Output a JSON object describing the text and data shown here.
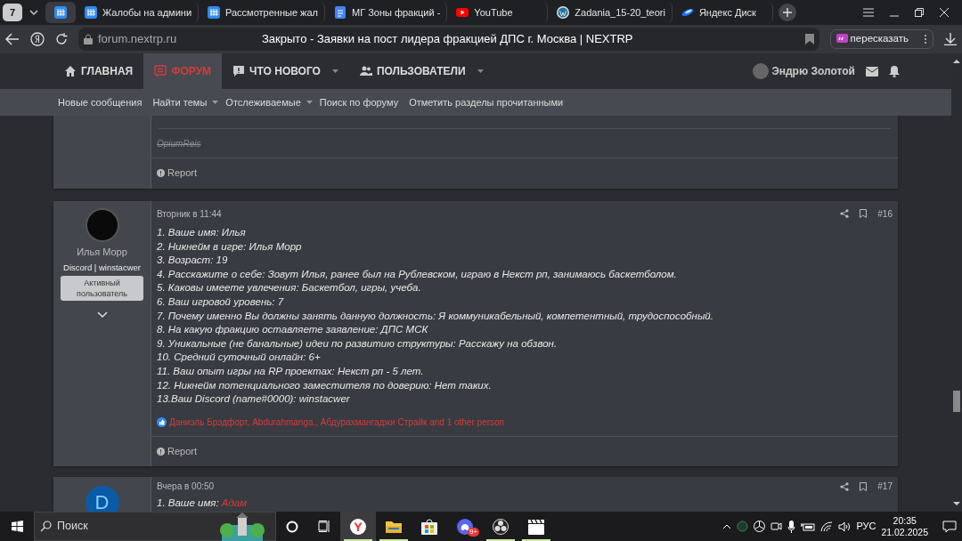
{
  "browser": {
    "tab_count": "7",
    "tabs": [
      {
        "kind": "forum",
        "selected": true
      },
      {
        "kind": "forum",
        "title": "Жалобы на админи",
        "selected": false
      },
      {
        "kind": "forum",
        "title": "Рассмотренные жал",
        "selected": false
      },
      {
        "kind": "doc",
        "title": "МГ Зоны фракций -",
        "selected": false
      },
      {
        "kind": "youtube",
        "title": "YouTube",
        "selected": false
      },
      {
        "kind": "wordpress",
        "title": "Zadania_15-20_teori",
        "selected": false
      },
      {
        "kind": "disk",
        "title": "Яндекс Диск",
        "selected": false
      }
    ],
    "domain": "forum.nextrp.ru",
    "page_title": "Закрыто - Заявки на пост лидера фракцией ДПС г. Москва | NEXTRP",
    "summarize_button": "пересказать"
  },
  "forum_nav": {
    "items": [
      {
        "kind": "home",
        "label": "ГЛАВНАЯ",
        "selected": false,
        "dropdown": false
      },
      {
        "kind": "forum",
        "label": "ФОРУМ",
        "selected": true,
        "dropdown": false
      },
      {
        "kind": "news",
        "label": "ЧТО НОВОГО",
        "selected": false,
        "dropdown": true
      },
      {
        "kind": "users",
        "label": "ПОЛЬЗОВАТЕЛИ",
        "selected": false,
        "dropdown": true
      }
    ],
    "user_name": "Эндрю Золотой"
  },
  "sub_nav": [
    {
      "label": "Новые сообщения",
      "dropdown": false
    },
    {
      "label": "Найти темы",
      "dropdown": true
    },
    {
      "label": "Отслеживаемые",
      "dropdown": true
    },
    {
      "label": "Поиск по форуму",
      "dropdown": false
    },
    {
      "label": "Отметить разделы прочитанными",
      "dropdown": false
    }
  ],
  "posts": [
    {
      "kind": "cut",
      "signature": "OpiumReis",
      "report": "Report"
    },
    {
      "kind": "full",
      "author": "Илья Морр",
      "author_title": "Discord | winstacwer",
      "user_badge": "Активный пользователь",
      "date": "Вторник в 11:44",
      "number": "#16",
      "lines": [
        {
          "text": "1. Ваше имя: Илья"
        },
        {
          "text": "2. Никнейм в игре: Илья Морр"
        },
        {
          "text": "3. Возраст: 19"
        },
        {
          "text": "4. Расскажите о себе: Зовут Илья, ранее был на Рублевском, играю в Некст рп, занимаюсь баскетболом."
        },
        {
          "text": "5. Каковы имеете увлечения: Баскетбол, игры, учеба."
        },
        {
          "text": "6. Ваш игровой уровень: 7"
        },
        {
          "text": "7. Почему именно Вы должны занять данную должность: Я коммуникабельный, компетентный, трудоспособный."
        },
        {
          "text": "8. На какую фракцию оставляете заявление: ДПС МСК"
        },
        {
          "text": "9. Уникальные (не банальные) идеи по развитию структуры: Расскажу на обзвон."
        },
        {
          "text": "10. Средний суточный онлайн: 6+"
        },
        {
          "text": "11. Ваш опыт игры на RP проектах: Некст рп - 5 лет."
        },
        {
          "text": "12. Никнейм потенциального заместителя по доверию: Нет таких."
        },
        {
          "text": "13.Ваш Discord (name#0000): winstacwer"
        }
      ],
      "reactions": "Даниэль Брэдфорт, Abdurahmanga., Абдурахмангаджи Страйк and 1 other person",
      "report": "Report"
    },
    {
      "kind": "full",
      "avatar_letter": "D",
      "date": "Вчера в 00:50",
      "number": "#17",
      "lines": [
        {
          "text": "1. Ваше имя:",
          "highlight": "Адам"
        }
      ]
    }
  ],
  "taskbar": {
    "search_placeholder": "Поиск",
    "apps": [
      {
        "kind": "yandex",
        "selected": true,
        "running": true
      },
      {
        "kind": "folder",
        "selected": false,
        "running": true
      },
      {
        "kind": "store",
        "selected": false,
        "running": false
      },
      {
        "kind": "discord",
        "selected": false,
        "running": false,
        "badge": "9+"
      },
      {
        "kind": "obs",
        "selected": false,
        "running": true
      },
      {
        "kind": "clapper",
        "selected": false,
        "running": true
      }
    ],
    "language": "РУС",
    "time": "20:35",
    "date": "21.02.2025"
  }
}
